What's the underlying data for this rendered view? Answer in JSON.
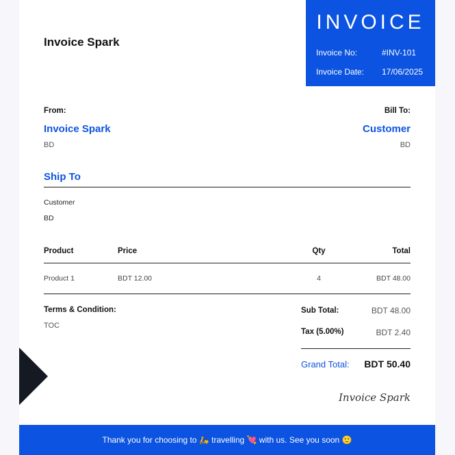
{
  "company": {
    "name": "Invoice Spark"
  },
  "invoice": {
    "title": "INVOICE",
    "number_label": "Invoice No:",
    "number": "#INV-101",
    "date_label": "Invoice Date:",
    "date": "17/06/2025"
  },
  "from": {
    "label": "From:",
    "name": "Invoice Spark",
    "country": "BD"
  },
  "bill_to": {
    "label": "Bill To:",
    "name": "Customer",
    "country": "BD"
  },
  "ship_to": {
    "heading": "Ship To",
    "name": "Customer",
    "country": "BD"
  },
  "table": {
    "headers": {
      "product": "Product",
      "price": "Price",
      "qty": "Qty",
      "total": "Total"
    },
    "rows": [
      {
        "product": "Product 1",
        "price": "BDT 12.00",
        "qty": "4",
        "total": "BDT 48.00"
      }
    ]
  },
  "terms": {
    "label": "Terms & Condition:",
    "text": "TOC"
  },
  "totals": {
    "subtotal_label": "Sub Total:",
    "subtotal": "BDT 48.00",
    "tax_label": "Tax (5.00%)",
    "tax": "BDT 2.40",
    "grand_label": "Grand Total:",
    "grand": "BDT 50.40"
  },
  "signature": "Invoice Spark",
  "footer": {
    "text": "Thank you for choosing to 🛵 travelling 💘 with us. See you soon 🙂"
  },
  "colors": {
    "accent": "#0b53e0",
    "dark": "#141922"
  }
}
